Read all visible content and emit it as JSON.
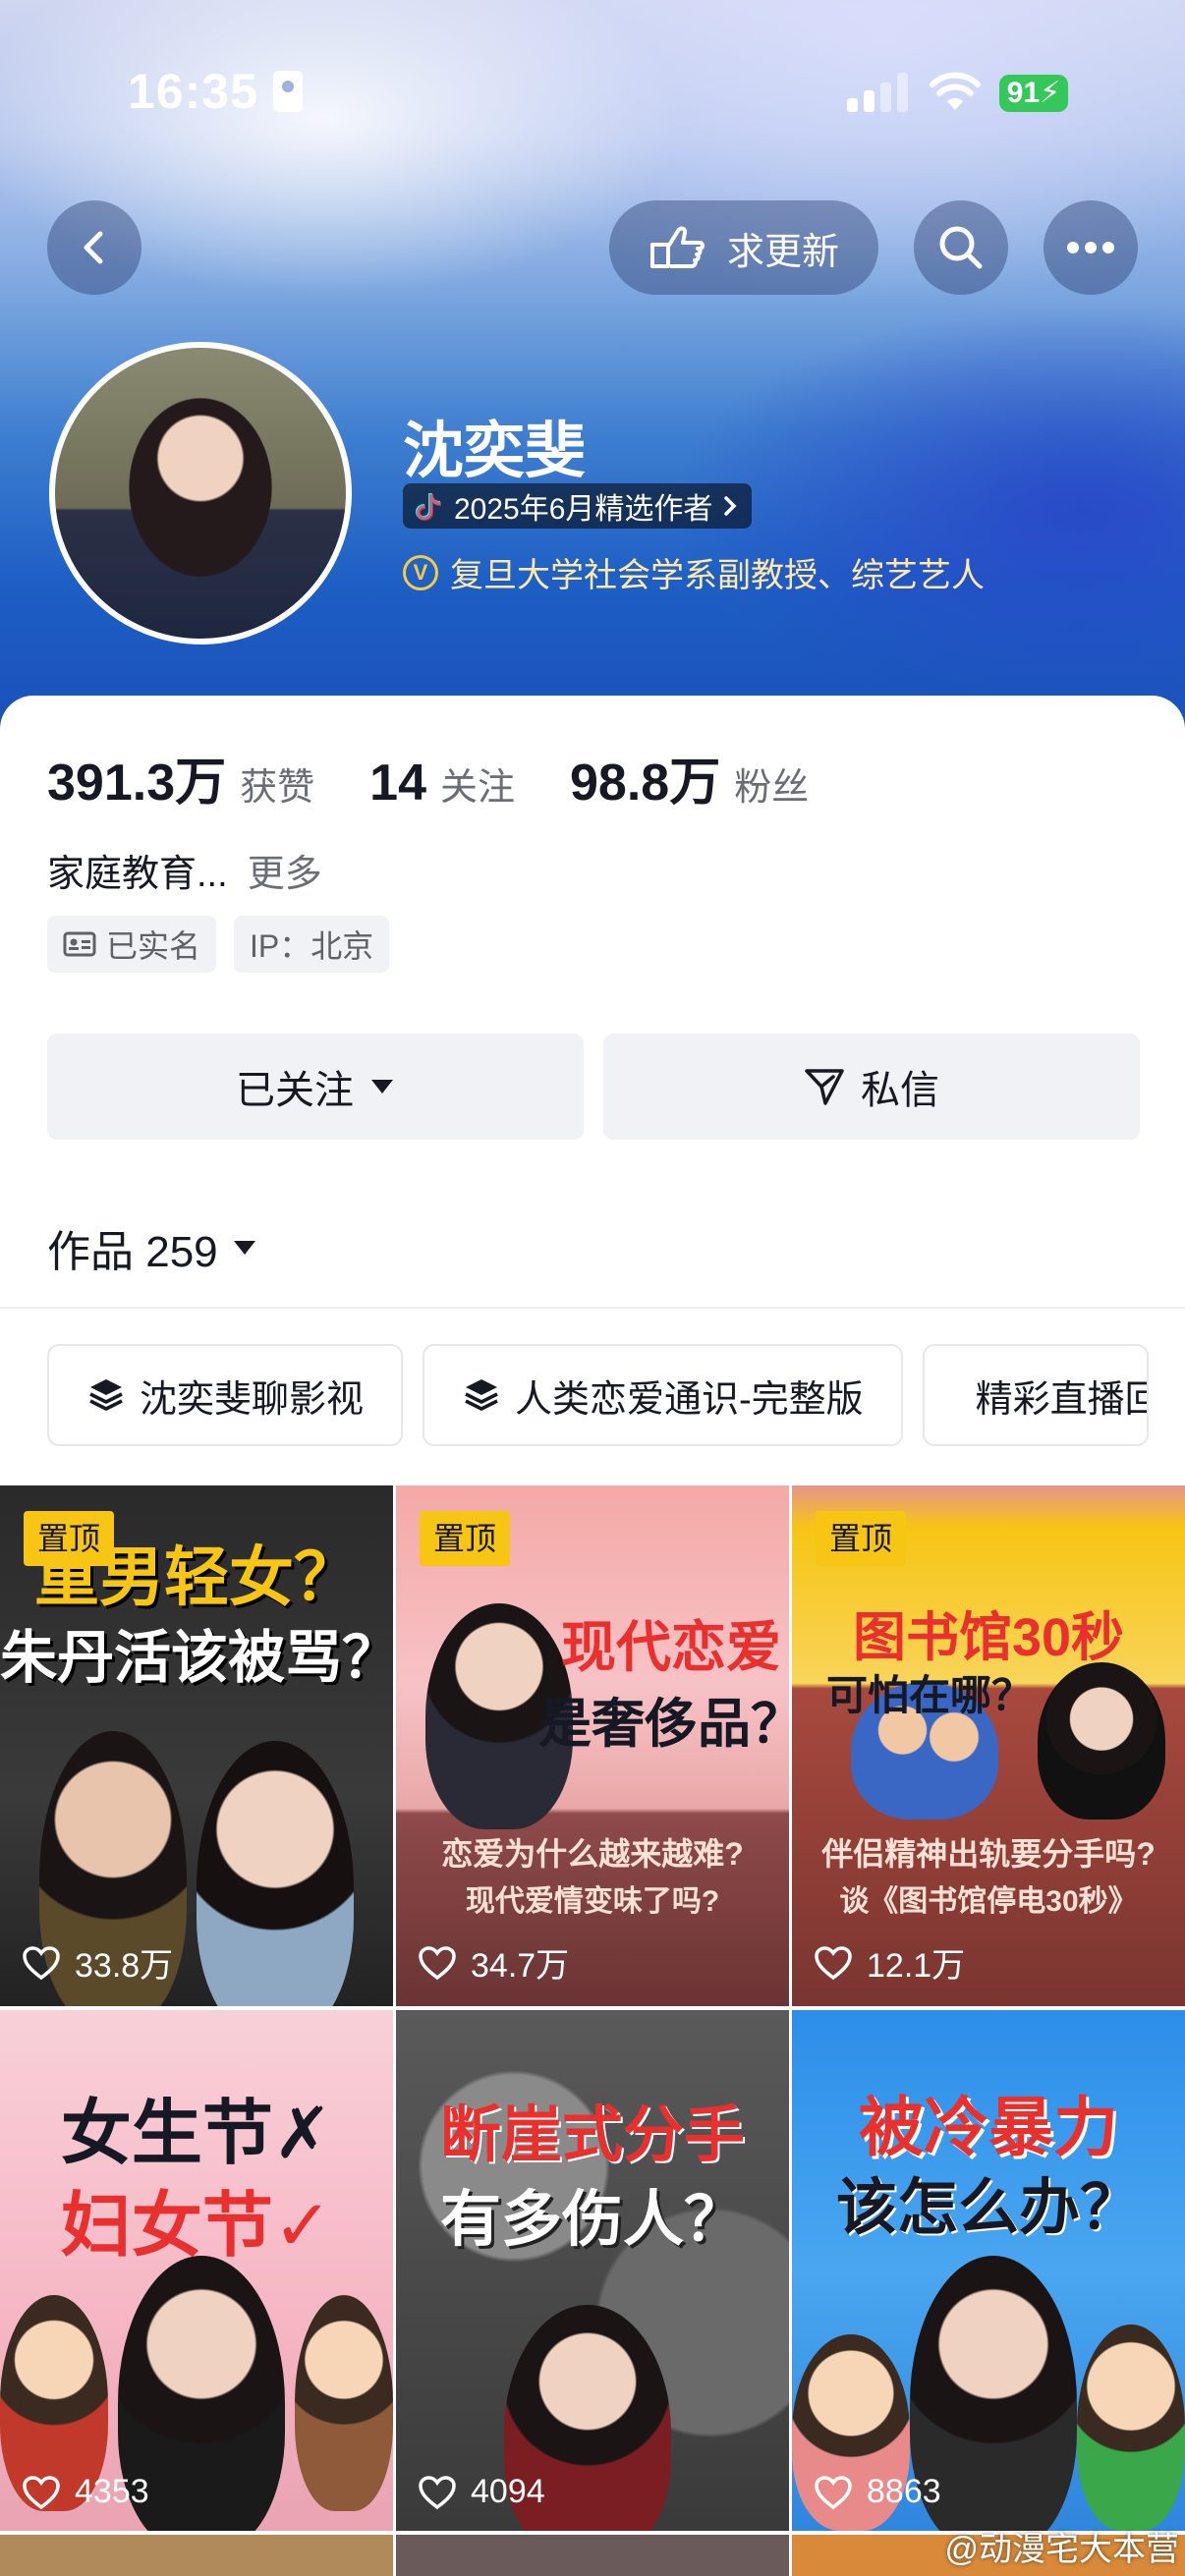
{
  "status_bar": {
    "time": "16:35",
    "battery": "91"
  },
  "header": {
    "request_update_label": "求更新"
  },
  "profile": {
    "name": "沈奕斐",
    "badge": "2025年6月精选作者",
    "verification": "复旦大学社会学系副教授、综艺艺人"
  },
  "stats": [
    {
      "value": "391.3万",
      "label": "获赞"
    },
    {
      "value": "14",
      "label": "关注"
    },
    {
      "value": "98.8万",
      "label": "粉丝"
    }
  ],
  "bio": {
    "text": "家庭教育...",
    "more": "更多"
  },
  "tags": {
    "realname": "已实名",
    "ip": "IP：北京"
  },
  "actions": {
    "follow": "已关注",
    "message": "私信"
  },
  "works": {
    "label": "作品 259"
  },
  "playlists": [
    "沈奕斐聊影视",
    "人类恋爱通识-完整版",
    "精彩直播回"
  ],
  "videos": [
    {
      "pinned": "置顶",
      "title": [
        "重男轻女？",
        "朱丹活该被骂？"
      ],
      "likes": "33.8万"
    },
    {
      "pinned": "置顶",
      "title": [
        "现代恋爱",
        "是奢侈品？"
      ],
      "sub": [
        "恋爱为什么越来越难?",
        "现代爱情变味了吗?"
      ],
      "likes": "34.7万"
    },
    {
      "pinned": "置顶",
      "title": [
        "图书馆30秒",
        "可怕在哪？"
      ],
      "sub": [
        "伴侣精神出轨要分手吗?",
        "谈《图书馆停电30秒》"
      ],
      "likes": "12.1万"
    },
    {
      "title": [
        "女生节✗",
        "妇女节✓"
      ],
      "likes": "4353"
    },
    {
      "title": [
        "断崖式分手",
        "有多伤人？"
      ],
      "likes": "4094"
    },
    {
      "title": [
        "被冷暴力",
        "该怎么办？"
      ],
      "likes": "8863"
    }
  ],
  "watermark": "@动漫宅大本营",
  "colors": {
    "accent_yellow": "#f7c514",
    "tile_red": "#e8302e",
    "header_blue": "#1d5fc4"
  }
}
